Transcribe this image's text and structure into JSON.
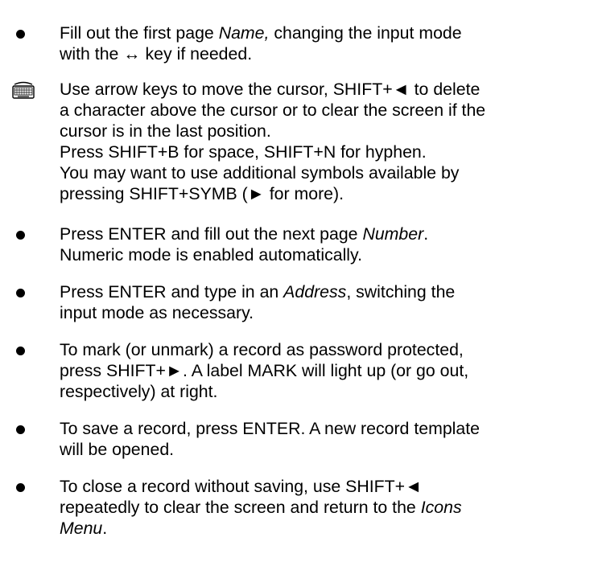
{
  "instructions": [
    {
      "marker": "bullet",
      "lines": [
        [
          "Fill out the first page ",
          {
            "em": "Name,"
          },
          " changing the input mode"
        ],
        [
          "with the ↔ key if needed."
        ]
      ]
    },
    {
      "marker": "keyboard-icon",
      "lines": [
        [
          "Use arrow keys to move the cursor, SHIFT+◄ to delete"
        ],
        [
          "a character above the cursor or to clear the screen if the"
        ],
        [
          "cursor is in the last position."
        ],
        [
          "Press SHIFT+B for space, SHIFT+N for hyphen."
        ],
        [
          "You may want to use additional symbols available by"
        ],
        [
          "pressing SHIFT+SYMB (► for more)."
        ]
      ]
    },
    {
      "marker": "bullet",
      "lines": [
        [
          "Press ENTER and fill out the next page ",
          {
            "em": "Number"
          },
          "."
        ],
        [
          "Numeric mode is enabled automatically."
        ]
      ]
    },
    {
      "marker": "bullet",
      "lines": [
        [
          "Press ENTER and type in an ",
          {
            "em": "Address"
          },
          ", switching the"
        ],
        [
          "input mode as necessary."
        ]
      ]
    },
    {
      "marker": "bullet",
      "lines": [
        [
          "To mark (or unmark) a record as password protected,"
        ],
        [
          "press SHIFT+►. A label MARK will light up (or go out,"
        ],
        [
          "respectively) at right."
        ]
      ]
    },
    {
      "marker": "bullet",
      "lines": [
        [
          "To save a record, press ENTER. A new record template"
        ],
        [
          "will be opened."
        ]
      ]
    },
    {
      "marker": "bullet",
      "lines": [
        [
          "To close a record without saving, use SHIFT+◄"
        ],
        [
          "repeatedly to clear the screen and return to the ",
          {
            "em": "Icons"
          }
        ],
        [
          {
            "em": "Menu"
          },
          "."
        ]
      ]
    }
  ]
}
